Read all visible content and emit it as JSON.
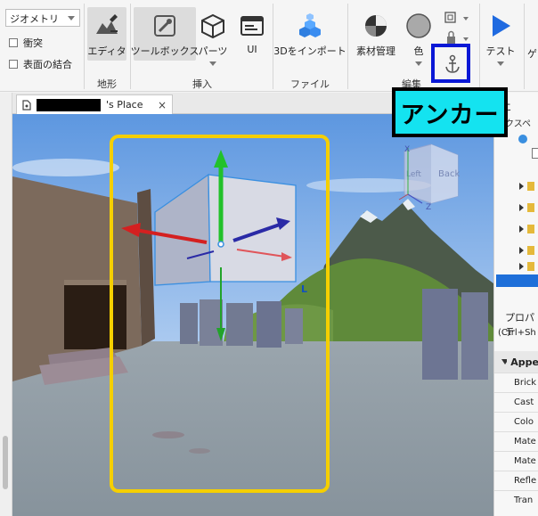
{
  "ribbon": {
    "geometry_dropdown": "ジオメトリ",
    "checkbox_collision": "衝突",
    "checkbox_join_surfaces": "表面の結合",
    "tools": {
      "editor": "エディタ",
      "toolbox": "ツールボックス",
      "parts": "パーツ",
      "ui": "UI",
      "import3d": "3Dをインポート",
      "material_manager": "素材管理",
      "color": "色",
      "test": "テスト"
    },
    "groups": {
      "terrain": "地形",
      "insert": "挿入",
      "file": "ファイル",
      "edit": "編集"
    }
  },
  "tab": {
    "title": "'s Place",
    "close": "×"
  },
  "viewcube": {
    "left_face": "Left",
    "back_face": "Back",
    "axis_x": "X",
    "axis_z": "Z"
  },
  "gizmo": {
    "local_indicator": "L"
  },
  "right_panel": {
    "explorer_title": "エ",
    "explorer_subtitle": "ークスペ",
    "properties_title": "プロパテ",
    "properties_filter": "(Ctrl+Sh",
    "properties_section": "Appe",
    "properties_rows": [
      "Brick",
      "Cast",
      "Colo",
      "Mate",
      "Mate",
      "Refle",
      "Tran"
    ]
  },
  "callout": {
    "text": "アンカー"
  },
  "colors": {
    "accent_blue": "#0a18d6",
    "callout_bg": "#14e3f0",
    "highlight_yellow": "#f5cf00",
    "sky_top": "#6aa1e4",
    "ground": "#8e9aa3"
  },
  "icons": {
    "editor": "terrain-editor-icon",
    "toolbox": "toolbox-icon",
    "parts": "cube-icon",
    "ui": "ui-window-icon",
    "import3d": "import-3d-icon",
    "material": "material-icon",
    "color": "color-circle-icon",
    "group": "group-icon",
    "lock": "lock-icon",
    "anchor": "anchor-icon",
    "test": "play-icon"
  }
}
